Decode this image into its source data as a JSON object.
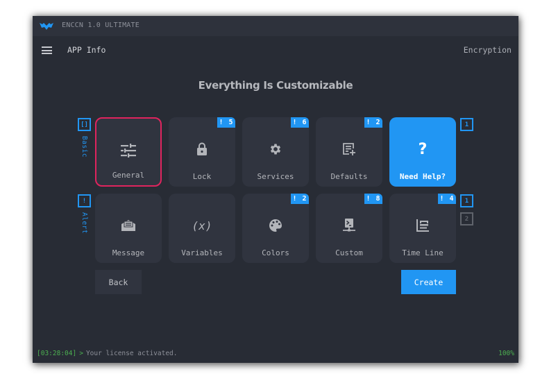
{
  "window": {
    "title": "ENCCN 1.0 ULTIMATE",
    "logo_icon": "bat-wing-logo"
  },
  "header": {
    "menu_icon": "hamburger-menu-icon",
    "page_title": "APP Info",
    "right_link": "Encryption"
  },
  "main": {
    "heading": "Everything Is Customizable",
    "groups": [
      {
        "box_glyph": "[]",
        "label": "Basic"
      },
      {
        "box_glyph": "!",
        "label": "Alert"
      }
    ],
    "row1_pager": [
      "1"
    ],
    "row2_pager": [
      "1",
      "2"
    ],
    "tiles_row1": [
      {
        "label": "General",
        "icon": "sliders-icon",
        "badge": null,
        "selected": true
      },
      {
        "label": "Lock",
        "icon": "lock-icon",
        "badge": "! 5"
      },
      {
        "label": "Services",
        "icon": "gear-icon",
        "badge": "! 6"
      },
      {
        "label": "Defaults",
        "icon": "note-add-icon",
        "badge": "! 2"
      },
      {
        "label": "Need Help?",
        "icon": "question-icon",
        "glyph": "?",
        "badge": null,
        "highlight": true
      }
    ],
    "tiles_row2": [
      {
        "label": "Message",
        "icon": "open-envelope-icon",
        "badge": null
      },
      {
        "label": "Variables",
        "icon": "variable-icon",
        "glyph": "(x)",
        "badge": null
      },
      {
        "label": "Colors",
        "icon": "palette-icon",
        "badge": "! 2"
      },
      {
        "label": "Custom",
        "icon": "terminal-network-icon",
        "badge": "! 8"
      },
      {
        "label": "Time Line",
        "icon": "timeline-icon",
        "badge": "! 4"
      }
    ],
    "back_label": "Back",
    "create_label": "Create"
  },
  "status_bar": {
    "time": "[03:28:04]",
    "prompt": ">",
    "message": "Your license activated.",
    "progress": "100%"
  },
  "colors": {
    "accent": "#2196f3",
    "selected_border": "#e0245e",
    "status_green": "#4caf50",
    "window_bg": "#282c35",
    "tile_bg": "#30343f"
  }
}
